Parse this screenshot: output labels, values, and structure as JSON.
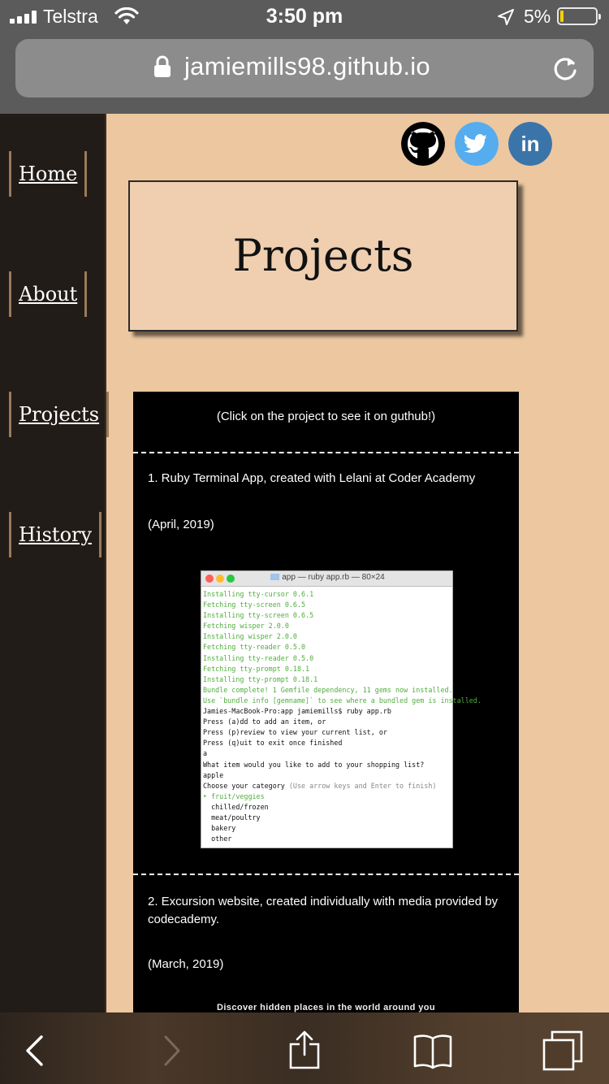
{
  "status_bar": {
    "carrier": "Telstra",
    "time": "3:50 pm",
    "battery_percent": "5%",
    "battery_level": 0.05
  },
  "browser": {
    "url": "jamiemills98.github.io"
  },
  "sidebar": {
    "items": [
      {
        "label": "Home"
      },
      {
        "label": "About"
      },
      {
        "label": "Projects"
      },
      {
        "label": "History"
      }
    ]
  },
  "social": [
    {
      "name": "github",
      "icon": "github-icon",
      "color": "#000000"
    },
    {
      "name": "twitter",
      "icon": "twitter-icon",
      "color": "#55acee"
    },
    {
      "name": "linkedin",
      "icon": "linkedin-icon",
      "color": "#3b74a9"
    }
  ],
  "page": {
    "title": "Projects",
    "hint": "(Click on the project to see it on guthub!)",
    "projects": [
      {
        "title": "1. Ruby Terminal App, created with Lelani at Coder Academy",
        "date": "(April, 2019)"
      },
      {
        "title": "2. Excursion website, created individually with media provided by codecademy.",
        "date": "(March, 2019)"
      }
    ],
    "preview_caption": "Discover hidden places in the world around you"
  },
  "terminal": {
    "title": "app — ruby app.rb — 80×24",
    "lines": [
      {
        "text": "Installing tty-cursor 0.6.1",
        "style": "green"
      },
      {
        "text": "Fetching tty-screen 0.6.5",
        "style": "green"
      },
      {
        "text": "Installing tty-screen 0.6.5",
        "style": "green"
      },
      {
        "text": "Fetching wisper 2.0.0",
        "style": "green"
      },
      {
        "text": "Installing wisper 2.0.0",
        "style": "green"
      },
      {
        "text": "Fetching tty-reader 0.5.0",
        "style": "green"
      },
      {
        "text": "Installing tty-reader 0.5.0",
        "style": "green"
      },
      {
        "text": "Fetching tty-prompt 0.18.1",
        "style": "green"
      },
      {
        "text": "Installing tty-prompt 0.18.1",
        "style": "green"
      },
      {
        "text": "Bundle complete! 1 Gemfile dependency, 11 gems now installed.",
        "style": "green"
      },
      {
        "text": "Use `bundle info [gemname]` to see where a bundled gem is installed.",
        "style": "green"
      },
      {
        "text": "Jamies-MacBook-Pro:app jamiemills$ ruby app.rb",
        "style": "normal"
      },
      {
        "text": "Press (a)dd to add an item, or",
        "style": "normal"
      },
      {
        "text": "Press (p)review to view your current list, or",
        "style": "normal"
      },
      {
        "text": "Press (q)uit to exit once finished",
        "style": "normal"
      },
      {
        "text": "a",
        "style": "normal"
      },
      {
        "text": "What item would you like to add to your shopping list?",
        "style": "normal"
      },
      {
        "text": "apple",
        "style": "normal"
      },
      {
        "text": "Choose your category",
        "style": "normal",
        "suffix": " (Use arrow keys and Enter to finish)"
      },
      {
        "text": "‣ fruit/veggies",
        "style": "green"
      },
      {
        "text": "  chilled/frozen",
        "style": "normal"
      },
      {
        "text": "  meat/poultry",
        "style": "normal"
      },
      {
        "text": "  bakery",
        "style": "normal"
      },
      {
        "text": "  other",
        "style": "normal"
      }
    ]
  },
  "toolbar": {
    "buttons": [
      "back-icon",
      "forward-icon",
      "share-icon",
      "bookmarks-icon",
      "tabs-icon"
    ]
  }
}
